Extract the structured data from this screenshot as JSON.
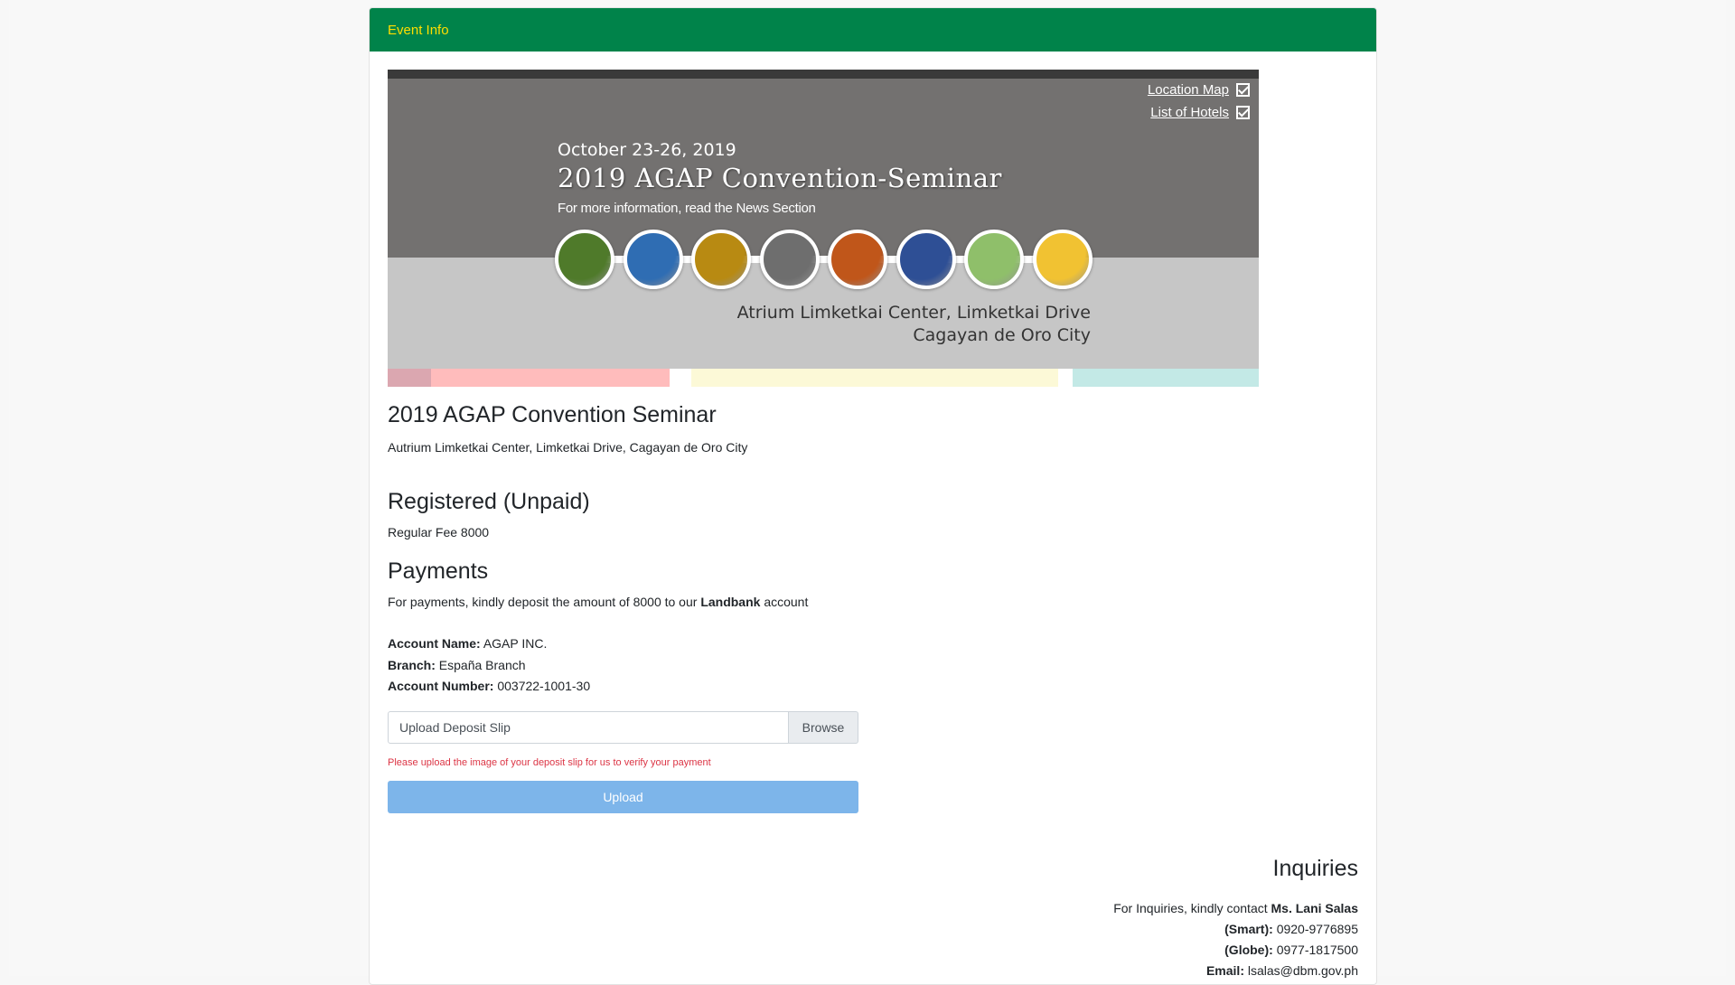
{
  "header": {
    "title": "Event Info"
  },
  "banner": {
    "date": "October 23-26, 2019",
    "title": "2019 AGAP Convention-Seminar",
    "subtitle": "For more information, read the News Section",
    "links": [
      {
        "label": "Location Map"
      },
      {
        "label": "List of Hotels"
      }
    ],
    "location_line1": "Atrium Limketkai Center, Limketkai Drive",
    "location_line2": "Cagayan de Oro City",
    "circle_colors": [
      "#4f7a2a",
      "#2f6db3",
      "#b88a12",
      "#6e6e6e",
      "#c0561a",
      "#2e4f95",
      "#8fbf6a",
      "#f1c232"
    ],
    "strip_colors": [
      "#dba7b0",
      "#ffbcbc",
      "#fcf9d7",
      "#c3e9e6"
    ]
  },
  "event": {
    "title": "2019 AGAP Convention Seminar",
    "location": "Autrium Limketkai Center, Limketkai Drive, Cagayan de Oro City"
  },
  "registration": {
    "status": "Registered (Unpaid)",
    "fee": "Regular Fee 8000"
  },
  "payments": {
    "title": "Payments",
    "text_prefix": "For payments, kindly deposit the amount of 8000 to our ",
    "bank": "Landbank",
    "text_suffix": " account",
    "account_name_label": "Account Name:",
    "account_name": "AGAP INC.",
    "branch_label": "Branch:",
    "branch": "España Branch",
    "account_number_label": "Account Number:",
    "account_number": "003722-1001-30",
    "upload_placeholder": "Upload Deposit Slip",
    "browse_label": "Browse",
    "upload_help": "Please upload the image of your deposit slip for us to verify your payment",
    "upload_button": "Upload"
  },
  "inquiries": {
    "title": "Inquiries",
    "text_prefix": "For Inquiries, kindly contact ",
    "contact_name": "Ms. Lani Salas",
    "smart_label": "(Smart):",
    "smart": "0920-9776895",
    "globe_label": "(Globe):",
    "globe": "0977-1817500",
    "email_label": "Email:",
    "email": "lsalas@dbm.gov.ph"
  },
  "colors": {
    "header_bg": "#00834a",
    "header_text": "#ffde00",
    "upload_button_bg": "#7db5ea",
    "help_text": "#dc3545"
  }
}
